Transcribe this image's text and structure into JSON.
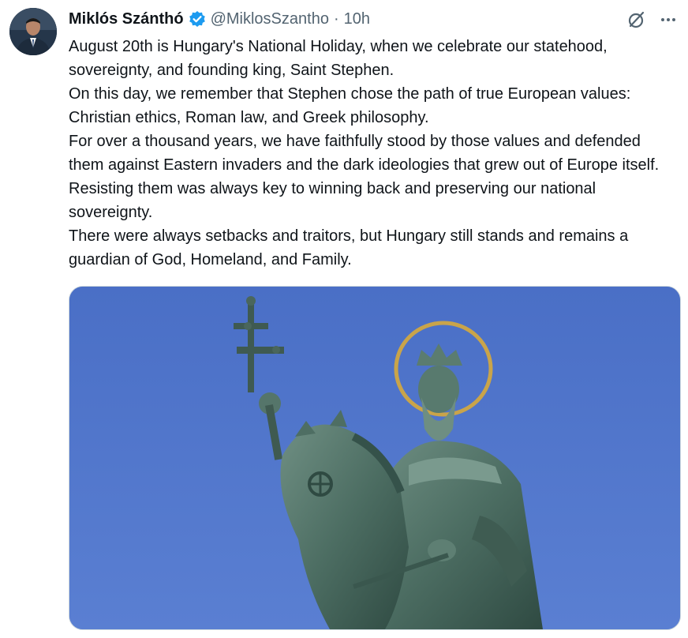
{
  "author": {
    "name": "Miklós Szánthó",
    "handle": "@MiklosSzantho",
    "separator": "·",
    "time": "10h",
    "verified": true,
    "avatar_icon": "profile-photo"
  },
  "actions": {
    "grok_icon": "grok-icon",
    "more_icon": "more-options-icon"
  },
  "tweet": {
    "paragraphs": [
      "August 20th is Hungary's National Holiday, when we celebrate our statehood, sovereignty, and founding king, Saint Stephen.",
      "On this day, we remember that Stephen chose the path of true European values: Christian ethics, Roman law, and Greek philosophy.",
      "For over a thousand years, we have faithfully stood by those values and defended them against Eastern invaders and the dark ideologies that grew out of Europe itself. Resisting them was always key to winning back and preserving our national sovereignty.",
      "There were always setbacks and traitors, but Hungary still stands and remains a guardian of God, Homeland, and Family."
    ]
  },
  "media": {
    "description_icon": "statue-photo",
    "sky_color": "#4f73c9",
    "statue_color": "#4c6d62",
    "halo_color": "#c9a44a"
  },
  "colors": {
    "text": "#0f1419",
    "secondary": "#536471",
    "verified": "#1d9bf0"
  }
}
